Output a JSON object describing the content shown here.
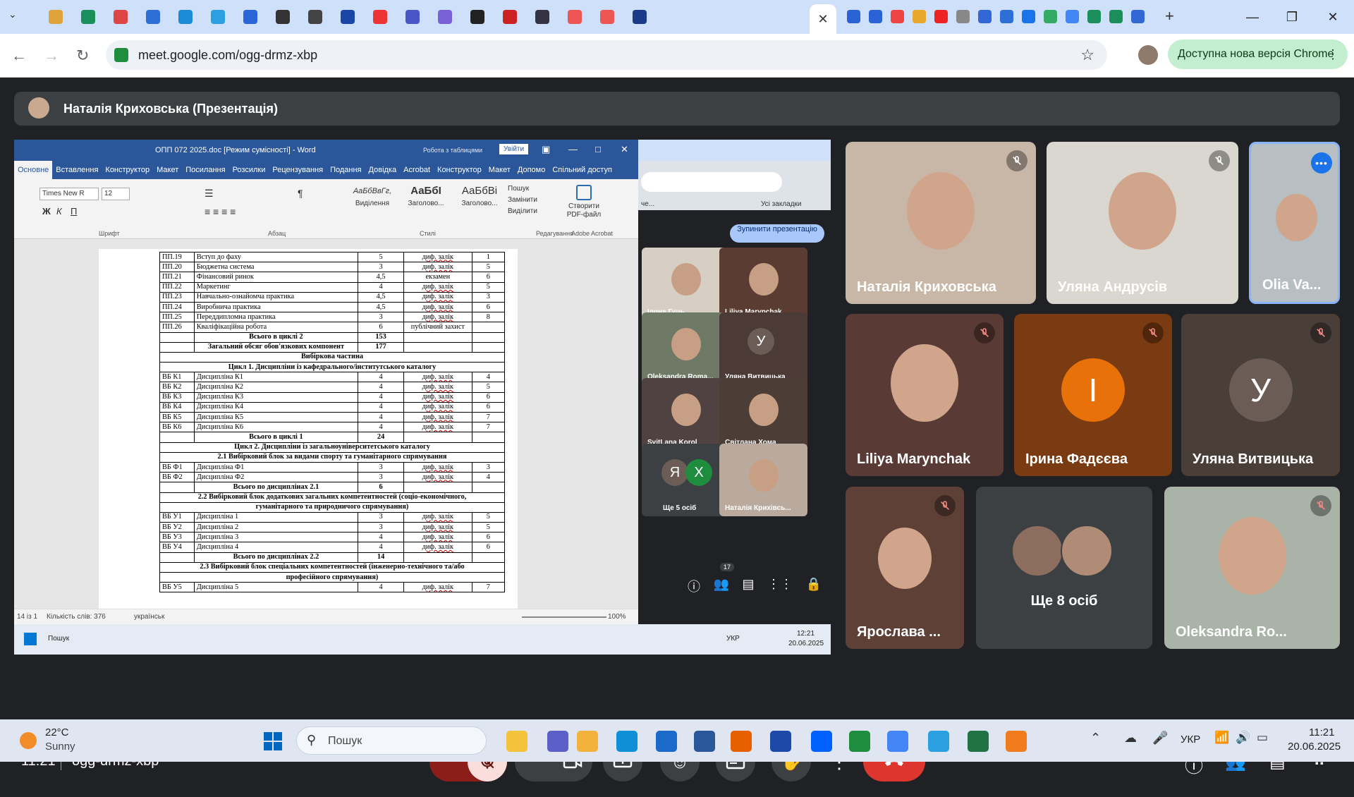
{
  "browser": {
    "url": "meet.google.com/ogg-drmz-xbp",
    "update_label": "Доступна нова версія Chrome",
    "tab_colors": [
      "#e0a23b",
      "#1a8f5c",
      "#d44",
      "#2d6fd6",
      "#1c8ad6",
      "#2aa0e0",
      "#2965d6",
      "#333",
      "#444",
      "#1a47a6",
      "#e33",
      "#4a56c8",
      "#7b5fd6",
      "#222",
      "#c22",
      "#334",
      "#e55",
      "#e55",
      "#1a3b8a"
    ],
    "right_tab_colors": [
      "#2963d6",
      "#2963d6",
      "#e44",
      "#e9a82b",
      "#e22",
      "#888",
      "#3367d6",
      "#2d6fd6",
      "#1a73e8",
      "#3a6",
      "#4285f4",
      "#1a8f5c",
      "#1a8f5c",
      "#3367d6"
    ]
  },
  "meet": {
    "presenter_title": "Наталія Криховська (Презентація)",
    "meeting_code": "ogg-drmz-xbp",
    "time": "11:21",
    "participants_count": "17",
    "tiles": [
      {
        "name": "Наталія Криховська",
        "muted": true
      },
      {
        "name": "Уляна Андрусів",
        "muted": true
      },
      {
        "name": "Olia Va...",
        "muted": false
      },
      {
        "name": "Liliya Marynchak",
        "muted": true
      },
      {
        "name": "Ірина Фадєєва",
        "muted": true,
        "letter": "І",
        "color": "#e8710a"
      },
      {
        "name": "Уляна Витвицька",
        "muted": true,
        "letter": "У",
        "color": "#6b5c55"
      },
      {
        "name": "Ярослава ...",
        "muted": true
      },
      {
        "name": "Ще 8 осіб",
        "muted": false
      },
      {
        "name": "Oleksandra Ro...",
        "muted": true
      }
    ]
  },
  "shared": {
    "word_title": "ОПП 072 2025.doc [Режим сумісності] - Word",
    "table_tools": "Робота з таблицями",
    "signin": "Увійти",
    "tabs": [
      "Основне",
      "Вставлення",
      "Конструктор",
      "Макет",
      "Посилання",
      "Розсилки",
      "Рецензування",
      "Подання",
      "Довідка",
      "Acrobat",
      "Конструктор",
      "Макет",
      "Допомо",
      "Спільний доступ"
    ],
    "font_name": "Times New R",
    "font_size": "12",
    "styles": [
      "АаБбВвГг,",
      "АаБбІ",
      "АаБбВі"
    ],
    "style_labels": [
      "Виділення",
      "Заголово...",
      "Заголово..."
    ],
    "ribbon_groups": [
      "Шрифт",
      "Абзац",
      "Стилі",
      "Редагування",
      "Adobe Acrobat"
    ],
    "edit_items": [
      "Пошук",
      "Замінити",
      "Виділити"
    ],
    "pdf_label": "Створити PDF-файл",
    "status_left": "14 із 1",
    "status_words": "Кількість слів: 376",
    "status_lang": "українськ",
    "zoom": "100%",
    "stop_present": "Зупинити презентацію",
    "inner_tiles": [
      {
        "name": "Ілона Гуць"
      },
      {
        "name": "Liliya Marynchak"
      },
      {
        "name": "Oleksandra Roma..."
      },
      {
        "name": "Уляна Витвицька",
        "letter": "У"
      },
      {
        "name": "SvitLana Korol"
      },
      {
        "name": "Світлана Хома"
      },
      {
        "name": "Ще 5 осіб",
        "letter": "Я",
        "letter2": "Х"
      },
      {
        "name": "Наталія Крихівсь..."
      }
    ],
    "inner_count": "17",
    "taskbar_search": "Пошук",
    "taskbar_lang": "УКР",
    "taskbar_time": "12:21",
    "taskbar_date": "20.06.2025",
    "chrome_bookmarks": "Усі закладки",
    "chrome_ce": "че...",
    "rows": [
      [
        "ПП.19",
        "Вступ до фаху",
        "5",
        "диф. залік",
        "1"
      ],
      [
        "ПП.20",
        "Бюджетна система",
        "3",
        "диф. залік",
        "5"
      ],
      [
        "ПП.21",
        "Фінансовий ринок",
        "4,5",
        "екзамен",
        "6"
      ],
      [
        "ПП.22",
        "Маркетинг",
        "4",
        "диф. залік",
        "5"
      ],
      [
        "ПП.23",
        "Навчально-ознайомча практика",
        "4,5",
        "диф. залік",
        "3"
      ],
      [
        "ПП.24",
        "Виробнича практика",
        "4,5",
        "диф. залік",
        "6"
      ],
      [
        "ПП.25",
        "Переддипломна практика",
        "3",
        "диф. залік",
        "8"
      ],
      [
        "ПП.26",
        "Кваліфікаційна робота",
        "6",
        "публічний захист",
        ""
      ],
      [
        "",
        "Всього в циклі 2",
        "153",
        "",
        ""
      ],
      [
        "",
        "Загальний обсяг обов'язкових компонент",
        "177",
        "",
        ""
      ],
      [
        "Вибіркова частина"
      ],
      [
        "Цикл 1. Дисципліни із кафедрального/інститутського каталогу"
      ],
      [
        "ВБ К1",
        "Дисципліна К1",
        "4",
        "диф. залік",
        "4"
      ],
      [
        "ВБ К2",
        "Дисципліна К2",
        "4",
        "диф. залік",
        "5"
      ],
      [
        "ВБ К3",
        "Дисципліна К3",
        "4",
        "диф. залік",
        "6"
      ],
      [
        "ВБ К4",
        "Дисципліна К4",
        "4",
        "диф. залік",
        "6"
      ],
      [
        "ВБ К5",
        "Дисципліна К5",
        "4",
        "диф. залік",
        "7"
      ],
      [
        "ВБ К6",
        "Дисципліна К6",
        "4",
        "диф. залік",
        "7"
      ],
      [
        "",
        "Всього в циклі 1",
        "24",
        "",
        ""
      ],
      [
        "Цикл 2. Дисципліни із загальноуніверситетського каталогу"
      ],
      [
        "2.1 Вибірковий блок за видами спорту та гуманітарного спрямування"
      ],
      [
        "ВБ Ф1",
        "Дисципліна Ф1",
        "3",
        "диф. залік",
        "3"
      ],
      [
        "ВБ Ф2",
        "Дисципліна Ф2",
        "3",
        "диф. залік",
        "4"
      ],
      [
        "",
        "Всього по дисциплінах 2.1",
        "6",
        "",
        ""
      ],
      [
        "2.2 Вибірковий блок додаткових загальних компетентностей (соціо-економічного,"
      ],
      [
        "гуманітарного та природничого спрямування)"
      ],
      [
        "ВБ У1",
        "Дисципліна 1",
        "3",
        "диф. залік",
        "5"
      ],
      [
        "ВБ У2",
        "Дисципліна 2",
        "3",
        "диф. залік",
        "5"
      ],
      [
        "ВБ У3",
        "Дисципліна 3",
        "4",
        "диф. залік",
        "6"
      ],
      [
        "ВБ У4",
        "Дисципліна 4",
        "4",
        "диф. залік",
        "6"
      ],
      [
        "",
        "Всього по дисциплінах 2.2",
        "14",
        "",
        ""
      ],
      [
        "2.3 Вибірковий блок спеціальних компетентностей (інженерно-технічного та/або"
      ],
      [
        "професійного спрямування)"
      ],
      [
        "ВБ У5",
        "Дисципліна 5",
        "4",
        "диф. залік",
        "7"
      ]
    ]
  },
  "weather": {
    "temp": "22°C",
    "condition": "Sunny"
  },
  "taskbar": {
    "search": "Пошук",
    "lang": "УКР",
    "time": "11:21",
    "date": "20.06.2025"
  }
}
